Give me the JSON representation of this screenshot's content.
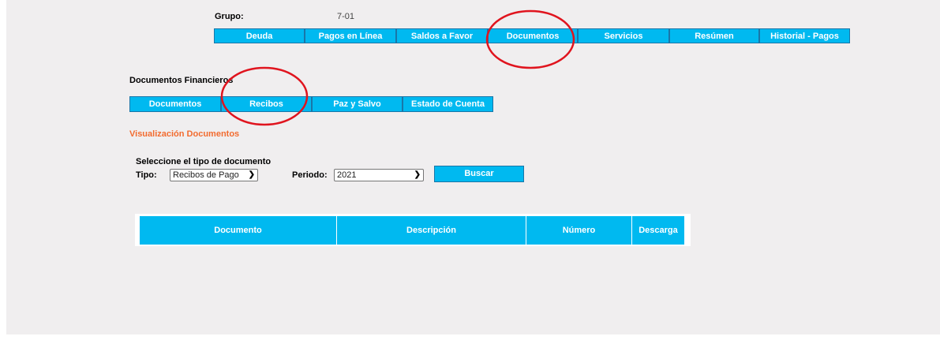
{
  "header": {
    "grupo_label": "Grupo:",
    "grupo_value": "7-01"
  },
  "main_tabs": [
    {
      "label": "Deuda"
    },
    {
      "label": "Pagos en Línea"
    },
    {
      "label": "Saldos a Favor"
    },
    {
      "label": "Documentos"
    },
    {
      "label": "Servicios"
    },
    {
      "label": "Resúmen"
    },
    {
      "label": "Historial - Pagos"
    }
  ],
  "section": {
    "title": "Documentos Financieros",
    "subtitle": "Visualización Documentos"
  },
  "doc_tabs": [
    {
      "label": "Documentos"
    },
    {
      "label": "Recibos"
    },
    {
      "label": "Paz y Salvo"
    },
    {
      "label": "Estado de Cuenta"
    }
  ],
  "filters": {
    "title": "Seleccione el tipo de documento",
    "tipo_label": "Tipo:",
    "tipo_value": "Recibos de Pago",
    "periodo_label": "Periodo:",
    "periodo_value": "2021",
    "search_label": "Buscar"
  },
  "table": {
    "headers": [
      "Documento",
      "Descripción",
      "Número",
      "Descarga"
    ]
  },
  "colors": {
    "accent": "#00b9f0",
    "subtitle": "#f26b2f",
    "annotation": "#e0141e"
  }
}
